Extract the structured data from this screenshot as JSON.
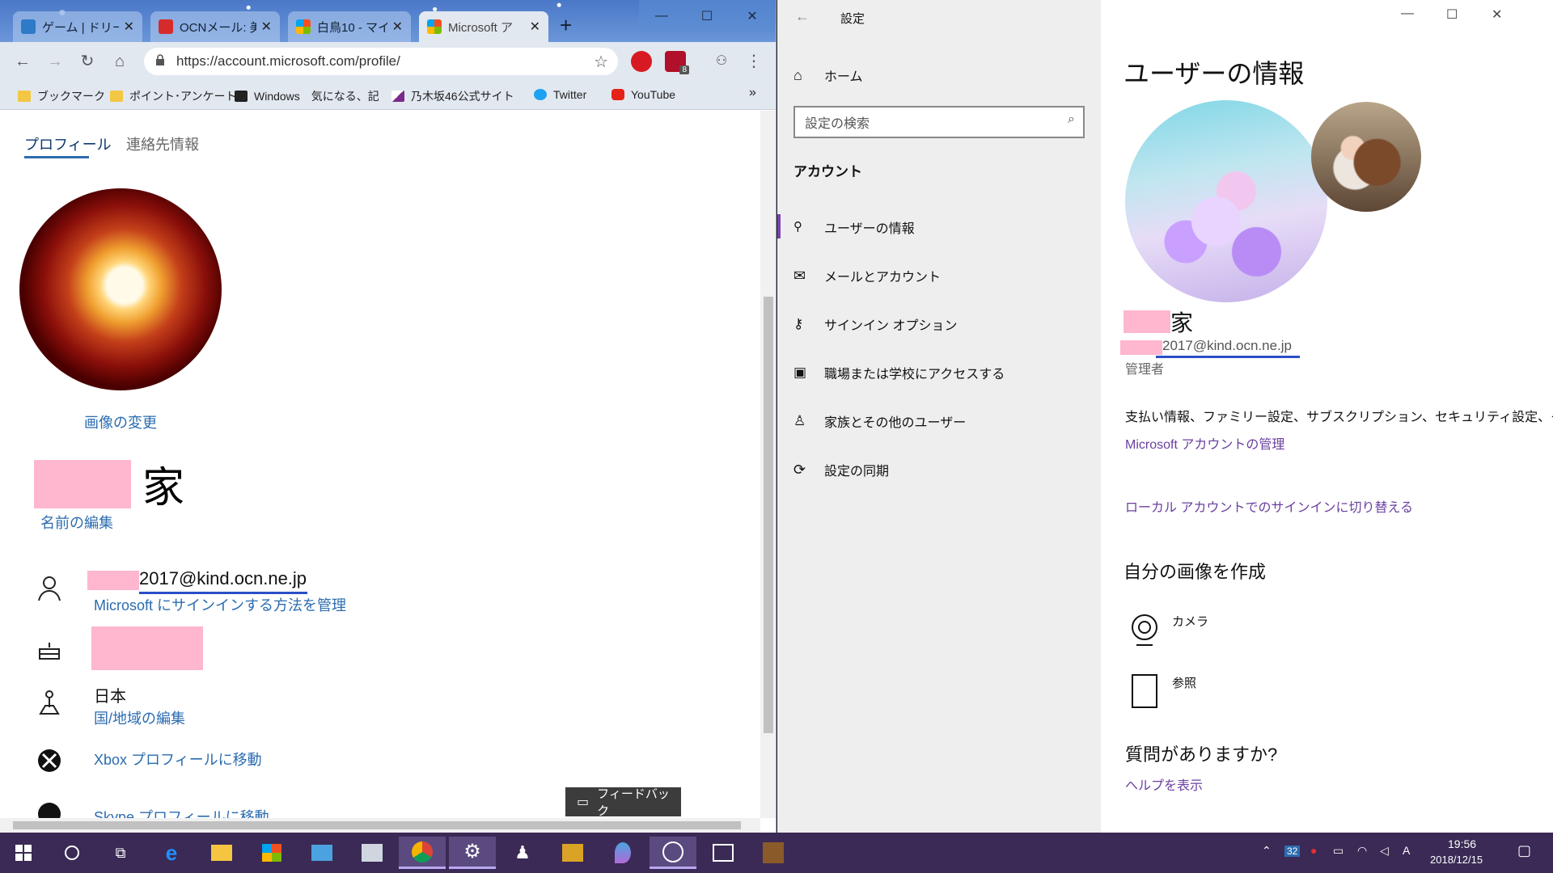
{
  "browser": {
    "tabs": [
      {
        "title": "ゲーム | ドリーム"
      },
      {
        "title": "OCNメール: 美"
      },
      {
        "title": "白鳥10 - マイ"
      },
      {
        "title": "Microsoft ア"
      }
    ],
    "new_tab": "+",
    "window_controls": {
      "minimize": "—",
      "maximize": "☐",
      "close": "✕"
    },
    "url": "https://account.microsoft.com/profile/",
    "extension_badge": "8",
    "bookmarks": [
      "ブックマーク",
      "ポイント･アンケート",
      "Windows　気になる、記",
      "乃木坂46公式サイト",
      "Twitter",
      "YouTube"
    ],
    "bookmarks_more": "»"
  },
  "profile": {
    "tabs": [
      "プロフィール",
      "連絡先情報"
    ],
    "change_image": "画像の変更",
    "name_suffix": "家",
    "edit_name": "名前の編集",
    "email": "2017@kind.ocn.ne.jp",
    "manage_signin": "Microsoft にサインインする方法を管理",
    "country": "日本",
    "edit_region": "国/地域の編集",
    "xbox_link": "Xbox プロフィールに移動",
    "skype_link": "Skype プロフィールに移動",
    "feedback": "フィードバック"
  },
  "settings": {
    "title": "設定",
    "home": "ホーム",
    "search_placeholder": "設定の検索",
    "section": "アカウント",
    "nav": [
      "ユーザーの情報",
      "メールとアカウント",
      "サインイン オプション",
      "職場または学校にアクセスする",
      "家族とその他のユーザー",
      "設定の同期"
    ],
    "page_title": "ユーザーの情報",
    "name_suffix": "家",
    "email": "2017@kind.ocn.ne.jp",
    "role": "管理者",
    "info_text": "支払い情報、ファミリー設定、サブスクリプション、セキュリティ設定、その他",
    "manage_account": "Microsoft アカウントの管理",
    "switch_local": "ローカル アカウントでのサインインに切り替える",
    "create_picture": "自分の画像を作成",
    "camera": "カメラ",
    "browse": "参照",
    "question": "質問がありますか?",
    "help": "ヘルプを表示"
  },
  "taskbar": {
    "tray_badge": "32",
    "time": "19:56",
    "date": "2018/12/15"
  }
}
